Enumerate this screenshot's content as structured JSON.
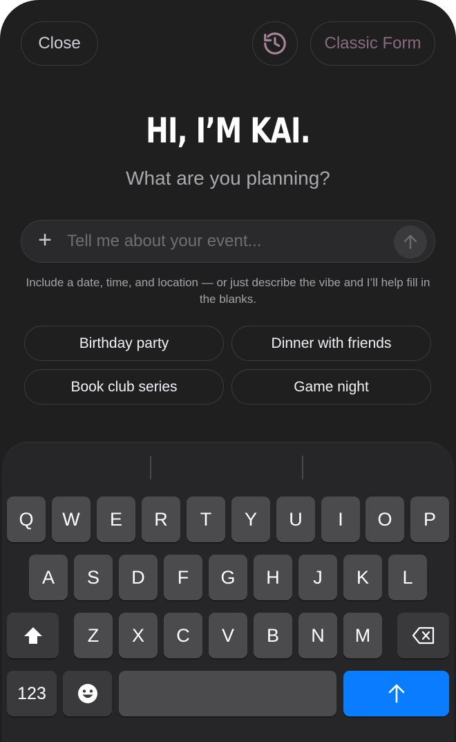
{
  "header": {
    "close_label": "Close",
    "history_icon": "history-icon",
    "classic_label": "Classic Form"
  },
  "hero": {
    "title": "HI, I’M KAI.",
    "subtitle": "What are you planning?"
  },
  "composer": {
    "placeholder": "Tell me about your event...",
    "plus_icon": "plus-icon",
    "send_icon": "arrow-up-icon"
  },
  "hint": "Include a date, time, and location — or just describe the vibe and I’ll help fill in the blanks.",
  "suggestions": [
    "Birthday party",
    "Dinner with friends",
    "Book club series",
    "Game night"
  ],
  "keyboard": {
    "row1": [
      "Q",
      "W",
      "E",
      "R",
      "T",
      "Y",
      "U",
      "I",
      "O",
      "P"
    ],
    "row2": [
      "A",
      "S",
      "D",
      "F",
      "G",
      "H",
      "J",
      "K",
      "L"
    ],
    "row3": [
      "Z",
      "X",
      "C",
      "V",
      "B",
      "N",
      "M"
    ],
    "numbers_label": "123",
    "shift_icon": "shift-icon",
    "delete_icon": "backspace-icon",
    "emoji_icon": "emoji-icon",
    "return_icon": "arrow-up-icon",
    "accent_color": "#0a7cff"
  }
}
